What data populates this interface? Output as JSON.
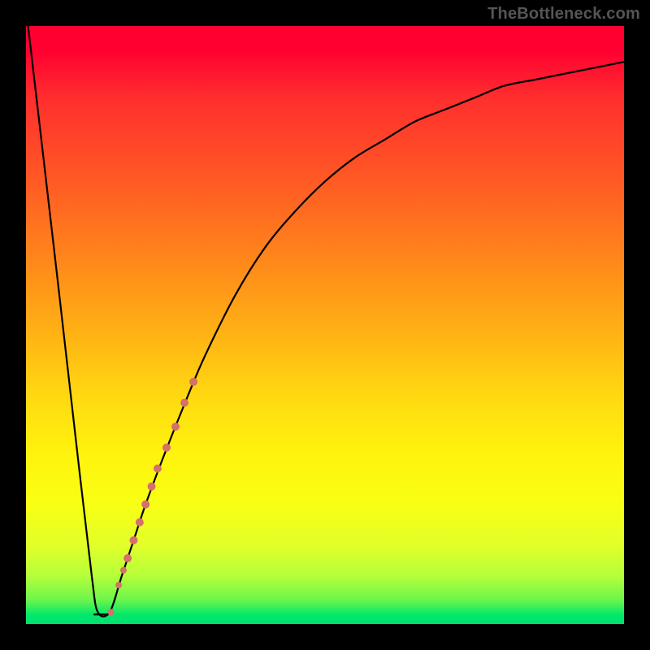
{
  "watermark": "TheBottleneck.com",
  "colors": {
    "background": "#000000",
    "curve": "#000000",
    "dots": "#d5706a"
  },
  "chart_data": {
    "type": "line",
    "title": "",
    "xlabel": "",
    "ylabel": "",
    "xlim": [
      0,
      100
    ],
    "ylim": [
      0,
      100
    ],
    "grid": false,
    "series": [
      {
        "name": "curve",
        "x": [
          0,
          5,
          9,
          11,
          12,
          14,
          16,
          18,
          20,
          23,
          27,
          30,
          35,
          40,
          45,
          50,
          55,
          60,
          65,
          70,
          75,
          80,
          85,
          90,
          95,
          100
        ],
        "values": [
          103,
          60,
          25,
          8,
          2,
          2,
          8,
          14,
          20,
          28,
          38,
          45,
          55,
          63,
          69,
          74,
          78,
          81,
          84,
          86,
          88,
          90,
          91,
          92,
          93,
          94
        ]
      }
    ],
    "markers": [
      {
        "x": 14.2,
        "y": 2.0,
        "r": 4
      },
      {
        "x": 15.5,
        "y": 6.5,
        "r": 4
      },
      {
        "x": 16.3,
        "y": 9.0,
        "r": 4
      },
      {
        "x": 17.0,
        "y": 11.0,
        "r": 5
      },
      {
        "x": 18.0,
        "y": 14.0,
        "r": 5
      },
      {
        "x": 19.0,
        "y": 17.0,
        "r": 5
      },
      {
        "x": 20.0,
        "y": 20.0,
        "r": 5
      },
      {
        "x": 21.0,
        "y": 23.0,
        "r": 5
      },
      {
        "x": 22.0,
        "y": 26.0,
        "r": 5
      },
      {
        "x": 23.5,
        "y": 29.5,
        "r": 5
      },
      {
        "x": 25.0,
        "y": 33.0,
        "r": 5
      },
      {
        "x": 26.5,
        "y": 37.0,
        "r": 5
      },
      {
        "x": 28.0,
        "y": 40.5,
        "r": 5
      }
    ]
  }
}
